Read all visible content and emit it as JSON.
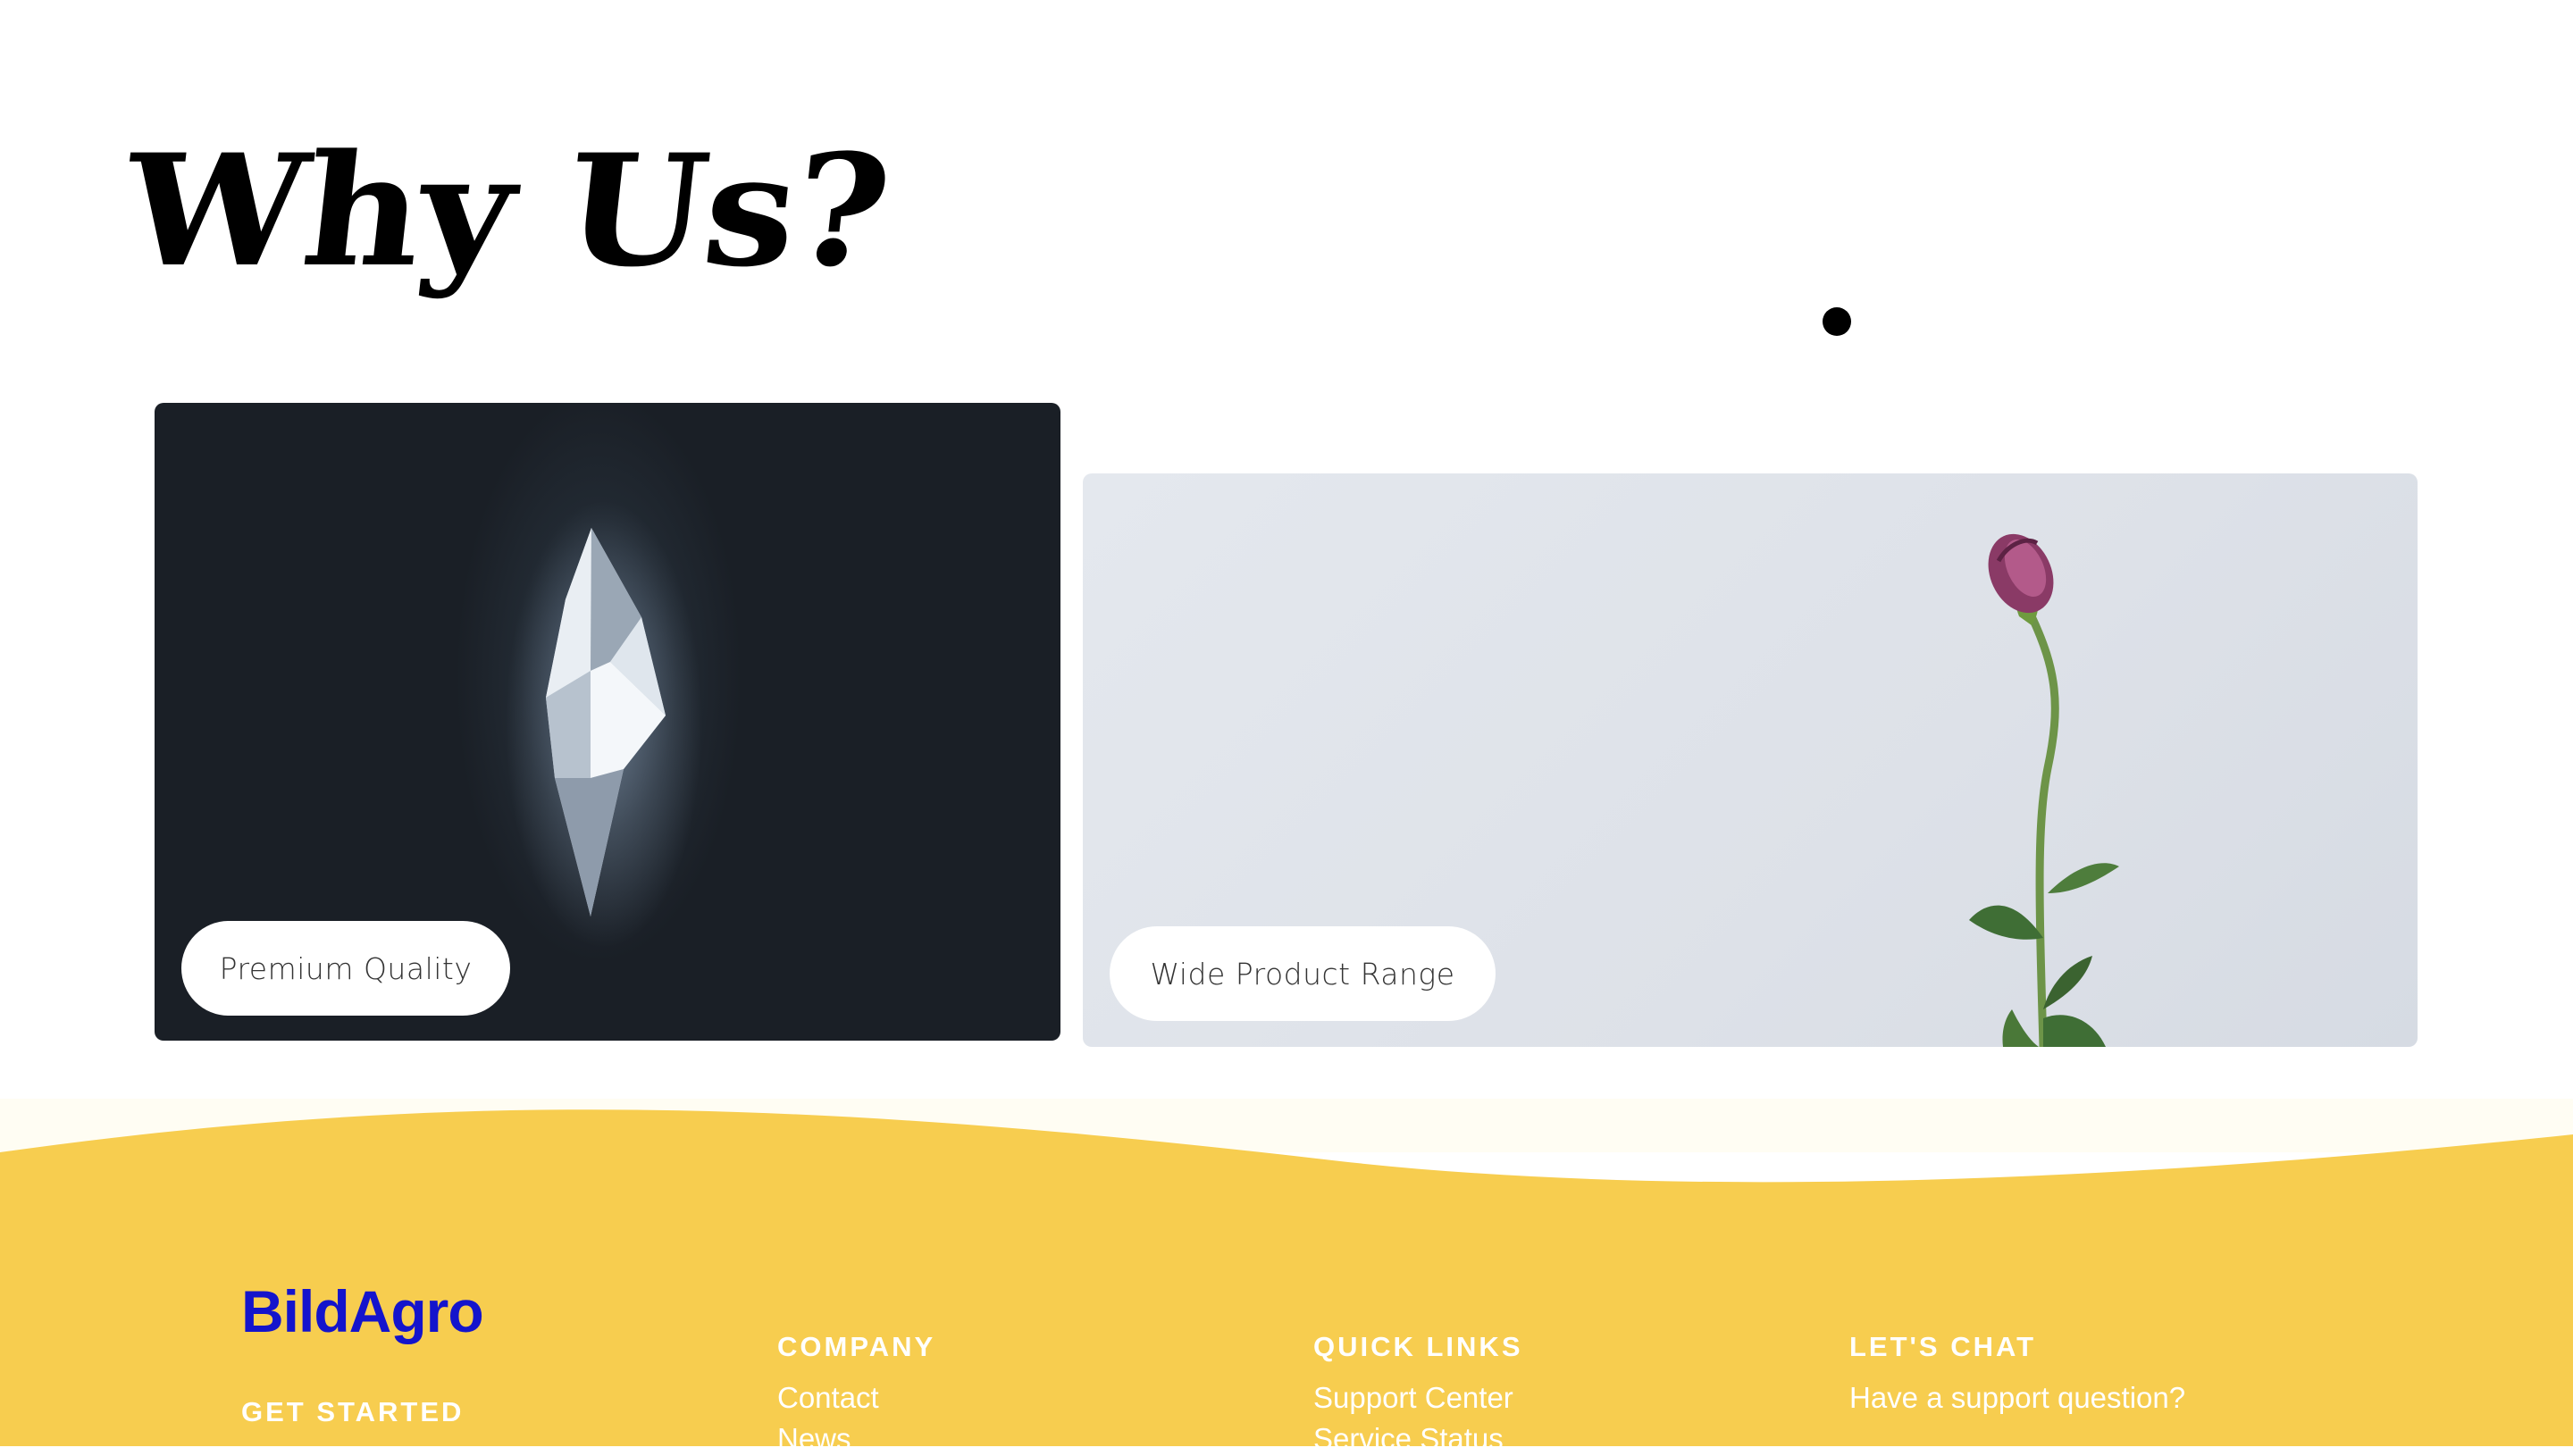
{
  "section": {
    "title": "Why Us?"
  },
  "cards": [
    {
      "label": "Premium Quality"
    },
    {
      "label": "Wide Product Range"
    }
  ],
  "footer": {
    "brand": "BildAgro",
    "get_started": "GET STARTED",
    "company": {
      "heading": "COMPANY",
      "links": [
        "Contact",
        "News"
      ]
    },
    "quick_links": {
      "heading": "QUICK LINKS",
      "links": [
        "Support Center",
        "Service Status"
      ]
    },
    "lets_chat": {
      "heading": "LET'S CHAT",
      "links": [
        "Have a support question?"
      ]
    }
  },
  "colors": {
    "footer_bg": "#f7cd4f",
    "brand": "#1414cc",
    "dark_card": "#1b2029",
    "light_card": "#dfe3ea"
  }
}
